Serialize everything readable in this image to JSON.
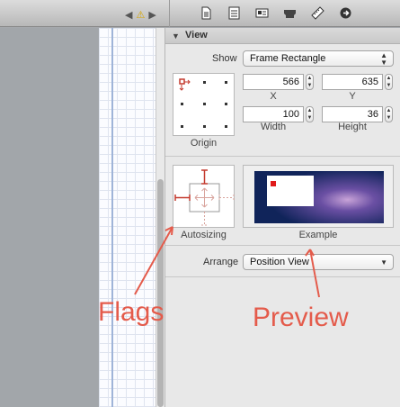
{
  "inspector": {
    "section_title": "View",
    "show_label": "Show",
    "show_value": "Frame Rectangle",
    "x_value": "566",
    "y_value": "635",
    "x_label": "X",
    "y_label": "Y",
    "width_value": "100",
    "height_value": "36",
    "width_label": "Width",
    "height_label": "Height",
    "origin_label": "Origin",
    "autosizing_label": "Autosizing",
    "example_label": "Example",
    "arrange_label": "Arrange",
    "arrange_value": "Position View"
  },
  "annotations": {
    "flags": "Flags",
    "preview": "Preview"
  },
  "toolbar": {
    "icons": [
      "file-inspector-icon",
      "quick-help-icon",
      "identity-inspector-icon",
      "attributes-inspector-icon",
      "size-inspector-icon",
      "connections-inspector-icon"
    ]
  },
  "colors": {
    "annotation": "#e45b4b",
    "strut": "#c43a2e",
    "preview_bg": "#1a3a73"
  }
}
